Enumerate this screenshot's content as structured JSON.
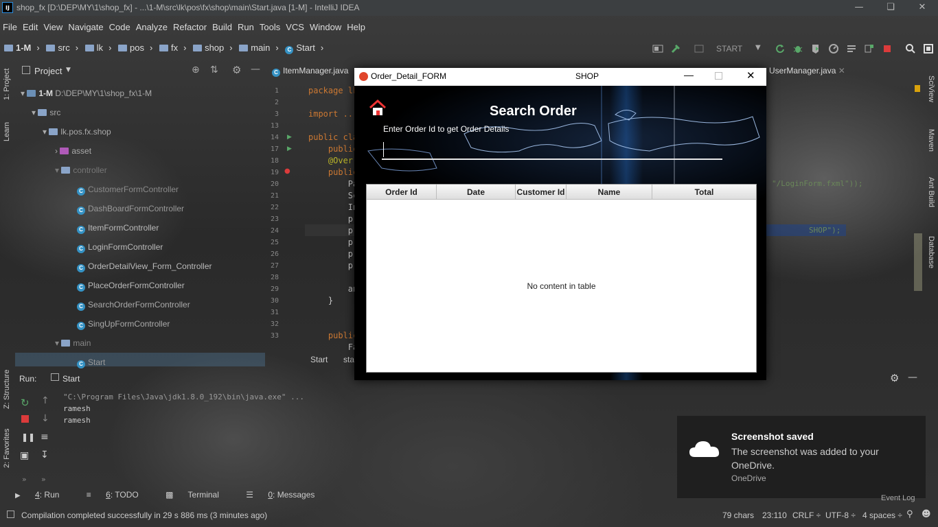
{
  "window": {
    "title": "shop_fx [D:\\DEP\\MY\\1\\shop_fx] - ...\\1-M\\src\\lk\\pos\\fx\\shop\\main\\Start.java [1-M] - IntelliJ IDEA",
    "app_icon": "IJ"
  },
  "menu": [
    "File",
    "Edit",
    "View",
    "Navigate",
    "Code",
    "Analyze",
    "Refactor",
    "Build",
    "Run",
    "Tools",
    "VCS",
    "Window",
    "Help"
  ],
  "breadcrumb": [
    "1-M",
    "src",
    "lk",
    "pos",
    "fx",
    "shop",
    "main",
    "Start"
  ],
  "run_config": "START",
  "project_panel": {
    "title": "Project",
    "tree": [
      {
        "label": "1-M",
        "extra": "D:\\DEP\\MY\\1\\shop_fx\\1-M",
        "kind": "module"
      },
      {
        "label": "src",
        "kind": "folder"
      },
      {
        "label": "lk.pos.fx.shop",
        "kind": "package"
      },
      {
        "label": "asset",
        "kind": "resource"
      },
      {
        "label": "controller",
        "kind": "folder"
      },
      {
        "label": "CustomerFormController",
        "kind": "class"
      },
      {
        "label": "DashBoardFormController",
        "kind": "class"
      },
      {
        "label": "ItemFormController",
        "kind": "class"
      },
      {
        "label": "LoginFormController",
        "kind": "class"
      },
      {
        "label": "OrderDetailView_Form_Controller",
        "kind": "class"
      },
      {
        "label": "PlaceOrderFormController",
        "kind": "class"
      },
      {
        "label": "SearchOrderFormController",
        "kind": "class"
      },
      {
        "label": "SingUpFormController",
        "kind": "class"
      },
      {
        "label": "main",
        "kind": "folder"
      },
      {
        "label": "Start",
        "kind": "class"
      }
    ]
  },
  "left_strip": [
    "1: Project",
    "Learn",
    "Z: Structure",
    "2: Favorites"
  ],
  "right_strip": [
    "SciView",
    "Maven",
    "Ant Build",
    "Database"
  ],
  "editor": {
    "tabs": [
      "ItemManager.java",
      "UserManager.java"
    ],
    "line_numbers": [
      "1",
      "2",
      "3",
      "13",
      "14",
      "17",
      "18",
      "19",
      "20",
      "21",
      "22",
      "23",
      "24",
      "25",
      "26",
      "27",
      "28",
      "29",
      "30",
      "31",
      "32",
      "33"
    ],
    "lines": [
      "package lk",
      "",
      "import ...",
      "public cla",
      "    public",
      "    @Overri",
      "    public",
      "        Pa",
      "        Sc",
      "        In",
      "        pr",
      "        pr",
      "        pr",
      "        pr",
      "        pr",
      "",
      "        an",
      "    }",
      "",
      "",
      "    public",
      "        Fa"
    ],
    "right_snippets": [
      "\"/LoginForm.fxml\"));",
      "SHOP\");"
    ],
    "breadcrumb_bottom": [
      "Start",
      "sta"
    ]
  },
  "fx_window": {
    "title": "Order_Detail_FORM",
    "center_title": "SHOP",
    "heading": "Search Order",
    "prompt": "Enter  Order Id to get Order Details",
    "home_icon": "home-icon",
    "columns": [
      "Order Id",
      "Date",
      "Customer Id",
      "Name",
      "Total"
    ],
    "empty_message": "No content in table"
  },
  "run_panel": {
    "label": "Run:",
    "tab": "Start",
    "console": [
      "\"C:\\Program Files\\Java\\jdk1.8.0_192\\bin\\java.exe\" ...",
      "ramesh",
      "ramesh"
    ]
  },
  "bottom_tools": [
    {
      "key": "4",
      "label": "Run"
    },
    {
      "key": "6",
      "label": "TODO"
    },
    {
      "key": "",
      "label": "Terminal"
    },
    {
      "key": "0",
      "label": "Messages"
    }
  ],
  "status_bar": {
    "message": "Compilation completed successfully in 29 s 886 ms (3 minutes ago)",
    "chars": "79 chars",
    "position": "23:110",
    "line_sep": "CRLF ÷",
    "encoding": "UTF-8 ÷",
    "indent": "4 spaces ÷",
    "event_log": "Event Log"
  },
  "toast": {
    "title": "Screenshot saved",
    "body": "The screenshot was added to your OneDrive.",
    "source": "OneDrive"
  },
  "colors": {
    "accent": "#2d8fe2",
    "run_green": "#59a869",
    "stop_red": "#db3b3b",
    "keyword": "#cc7832",
    "annotation": "#bbb529"
  }
}
